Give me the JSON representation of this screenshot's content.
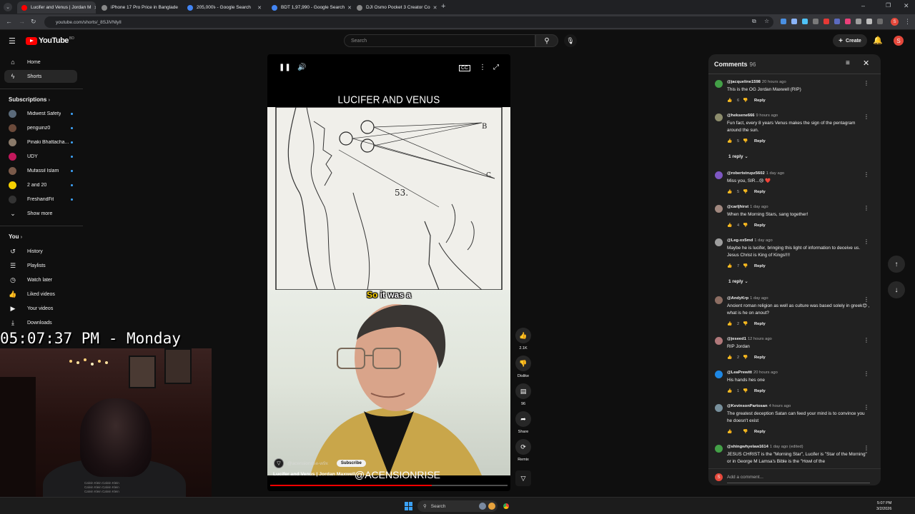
{
  "browser": {
    "tabs": [
      {
        "label": "Lucifer and Venus | Jordan M",
        "active": true,
        "color": "#ff0000"
      },
      {
        "label": "iPhone 17 Pro Price in Banglade",
        "active": false,
        "color": "#888888"
      },
      {
        "label": "205,000৳ - Google Search",
        "active": false,
        "color": "#4285f4"
      },
      {
        "label": "BDT 1,97,990 - Google Search",
        "active": false,
        "color": "#4285f4"
      },
      {
        "label": "DJI Osmo Pocket 3 Creator Co",
        "active": false,
        "color": "#888888"
      }
    ],
    "url": "youtube.com/shorts/_8SJiVNlylI"
  },
  "header": {
    "logo_text": "YouTube",
    "country": "BD",
    "search_placeholder": "Search",
    "create_label": "Create",
    "avatar_letter": "S"
  },
  "sidebar": {
    "main": [
      {
        "label": "Home",
        "icon": "home-icon",
        "glyph": "⌂"
      },
      {
        "label": "Shorts",
        "icon": "shorts-icon",
        "glyph": "ϟ",
        "active": true
      }
    ],
    "subscriptions_heading": "Subscriptions",
    "subscriptions": [
      {
        "label": "Midwest Safety",
        "color": "#5a6a7a"
      },
      {
        "label": "penguinz0",
        "color": "#6b4a3a"
      },
      {
        "label": "Pinaki Bhattacha...",
        "color": "#8a7a6a"
      },
      {
        "label": "UDY",
        "color": "#c2185b"
      },
      {
        "label": "Mufassil Islam",
        "color": "#7a5a4a"
      },
      {
        "label": "2 and 20",
        "color": "#f5d000"
      },
      {
        "label": "FreshandFit",
        "color": "#333333"
      }
    ],
    "show_more": "Show more",
    "you_heading": "You",
    "you_items": [
      {
        "label": "History",
        "icon": "history-icon",
        "glyph": "↺"
      },
      {
        "label": "Playlists",
        "icon": "playlists-icon",
        "glyph": "☰"
      },
      {
        "label": "Watch later",
        "icon": "watch-later-icon",
        "glyph": "◷"
      },
      {
        "label": "Liked videos",
        "icon": "liked-icon",
        "glyph": "👍"
      },
      {
        "label": "Your videos",
        "icon": "your-videos-icon",
        "glyph": "▶"
      },
      {
        "label": "Downloads",
        "icon": "downloads-icon",
        "glyph": "⤓"
      }
    ]
  },
  "overlay": {
    "clock": "05:07:37 PM - Monday"
  },
  "player": {
    "title_card": "LUCIFER AND VENUS",
    "caption_highlight": "So",
    "caption_rest": " it was a",
    "channel_handle": "@acensionrise-w9x",
    "subscribe_label": "Subscribe",
    "video_title": "Lucifer and Venus | Jordan Maxwell",
    "watermark": "@ACENSIONRISE",
    "progress_fraction": 0.68,
    "sketch_number": "53."
  },
  "actions": {
    "like_count": "2.1K",
    "dislike_label": "Dislike",
    "comment_count": "96",
    "share_label": "Share",
    "remix_label": "Remix"
  },
  "comments": {
    "heading": "Comments",
    "count": "96",
    "items": [
      {
        "user": "@jacqueline1598",
        "time": "20 hours ago",
        "text": "This is the OG Jordan Maxwell (RIP)",
        "likes": "6",
        "color": "#43a047"
      },
      {
        "user": "@heksene666",
        "time": "9 hours ago",
        "text": "Fun fact, every 8 years Venus makes the sign of the pentagram around the sun.",
        "likes": "5",
        "color": "#8d8d6d",
        "replies": "1 reply"
      },
      {
        "user": "@robertstrupz5602",
        "time": "1 day ago",
        "text": "Miss you, SIR...😢 ❤️",
        "likes": "5",
        "color": "#7e57c2"
      },
      {
        "user": "@carljhirst",
        "time": "1 day ago",
        "text": "When the Morning Stars, sang together!",
        "likes": "4",
        "color": "#a1887f"
      },
      {
        "user": "@Leg-xx5md",
        "time": "1 day ago",
        "text": "Maybe he is lucifer, bringing this light of information to deceive us. Jesus Christ is King of Kings!!!!",
        "likes": "7",
        "color": "#9e9e9e",
        "replies": "1 reply"
      },
      {
        "user": "@AndyKrp",
        "time": "1 day ago",
        "text": "Ancient roman religion as well as culture was based solely in greek😊 , what is he on anout?",
        "likes": "2",
        "color": "#8d6e63"
      },
      {
        "user": "@jeseed1",
        "time": "12 hours ago",
        "text": "RIP Jordan",
        "likes": "2",
        "color": "#b0787a"
      },
      {
        "user": "@LeaPrewitt",
        "time": "20 hours ago",
        "text": "His hands hes one",
        "likes": "1",
        "color": "#1e88e5"
      },
      {
        "user": "@KevinsonPartosan",
        "time": "4 hours ago",
        "text": "The greatest deception Satan can feed your mind is to convince you he doesn't exist",
        "likes": "",
        "color": "#78909c"
      },
      {
        "user": "@shingwhyelaw1614",
        "time": "1 day ago (edited)",
        "text": "JESUS CHRIST is the \"Morning Star\", Lucifer is \"Star of the Morning\" or in George M Lamsa's Bible is the \"Howl of the",
        "likes": "",
        "color": "#43a047"
      }
    ],
    "reply_label": "Reply",
    "add_placeholder": "Add a comment..."
  },
  "taskbar": {
    "search": "Search",
    "time": "5:07 PM",
    "date": "3/2/2026"
  }
}
